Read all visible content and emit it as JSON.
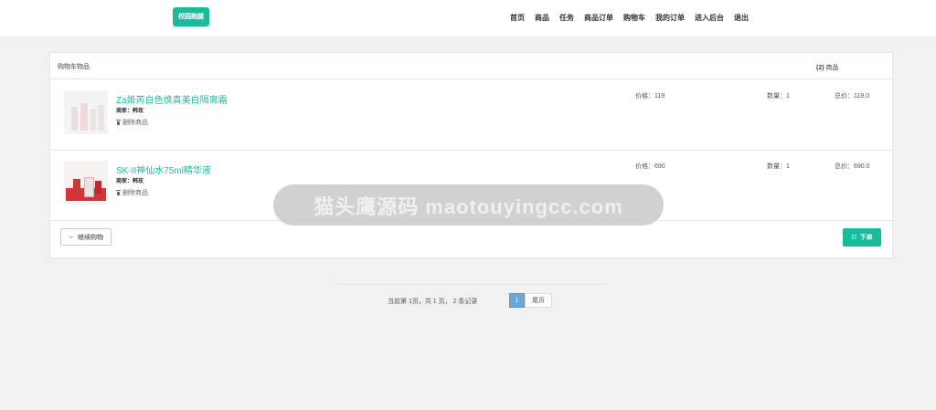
{
  "navbar": {
    "brand": "校园跑腿",
    "menu": [
      "首页",
      "商品",
      "任务",
      "商品订单",
      "购物车",
      "我的订单",
      "进入后台",
      "退出"
    ]
  },
  "cart": {
    "title": "购物车物品",
    "count": "(2)",
    "count_suffix": " 商品",
    "items": [
      {
        "name": "Za姬芮白色焕真美白隔离霜",
        "seller_label": "商家：",
        "seller": "韩玫",
        "delete_label": "删除商品",
        "price": "价格：119",
        "quantity": "数量：1",
        "total": "总价：119.0"
      },
      {
        "name": "SK-II神仙水75ml精华液",
        "seller_label": "商家：",
        "seller": "韩玫",
        "delete_label": "删除商品",
        "price": "价格：690",
        "quantity": "数量：1",
        "total": "总价：690.0"
      }
    ],
    "continue_label": "继续购物",
    "order_label": "下单"
  },
  "watermark": "猫头鹰源码 maotouyingcc.com",
  "pagination": {
    "info": "当前第 1页，共 1 页， 2 条记录",
    "current_page": "1",
    "last_label": "尾页"
  },
  "colors": {
    "accent": "#18bc9c",
    "page_active": "#6aa6d6",
    "background": "#f1f1f1"
  }
}
